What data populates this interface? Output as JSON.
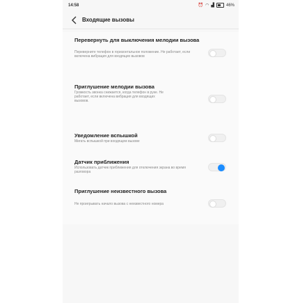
{
  "status_bar": {
    "time": "14:58",
    "battery": "46%"
  },
  "header": {
    "title": "Входящие вызовы"
  },
  "settings": [
    {
      "title": "Перевернуть для выключения мелодии вызова",
      "description": "Переверните телефон в горизонтальное положение. Не работает, если включена вибрация для входящих вызовов",
      "enabled": false
    },
    {
      "title": "Приглушение мелодии вызова",
      "description": "Громкость звонка снижается, когда телефон в руке. Не работает, если включена вибрация для входящих вызовов.",
      "enabled": false
    },
    {
      "title": "Уведомление вспышкой",
      "description": "Мигать вспышкой при входящем вызове",
      "enabled": false
    },
    {
      "title": "Датчик приближения",
      "description": "Использовать датчик приближения для отключения экрана во время разговора",
      "enabled": true
    },
    {
      "title": "Приглушение неизвестного вызова",
      "description": "Не проигрывать начало вызова с неизвестного номера",
      "enabled": false
    }
  ],
  "colors": {
    "accent": "#1a8cff"
  }
}
